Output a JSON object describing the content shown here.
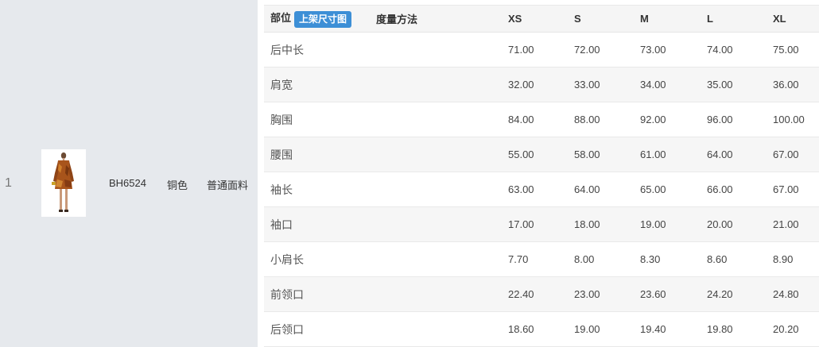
{
  "product": {
    "row_number": "1",
    "code": "BH6524",
    "color": "铜色",
    "fabric": "普通面料"
  },
  "size_table": {
    "header": {
      "part": "部位",
      "button": "上架尺寸图",
      "method": "度量方法",
      "sizes": [
        "XS",
        "S",
        "M",
        "L",
        "XL"
      ]
    },
    "rows": [
      {
        "part": "后中长",
        "method": "",
        "values": [
          "71.00",
          "72.00",
          "73.00",
          "74.00",
          "75.00"
        ]
      },
      {
        "part": "肩宽",
        "method": "",
        "values": [
          "32.00",
          "33.00",
          "34.00",
          "35.00",
          "36.00"
        ]
      },
      {
        "part": "胸围",
        "method": "",
        "values": [
          "84.00",
          "88.00",
          "92.00",
          "96.00",
          "100.00"
        ]
      },
      {
        "part": "腰围",
        "method": "",
        "values": [
          "55.00",
          "58.00",
          "61.00",
          "64.00",
          "67.00"
        ]
      },
      {
        "part": "袖长",
        "method": "",
        "values": [
          "63.00",
          "64.00",
          "65.00",
          "66.00",
          "67.00"
        ]
      },
      {
        "part": "袖口",
        "method": "",
        "values": [
          "17.00",
          "18.00",
          "19.00",
          "20.00",
          "21.00"
        ]
      },
      {
        "part": "小肩长",
        "method": "",
        "values": [
          "7.70",
          "8.00",
          "8.30",
          "8.60",
          "8.90"
        ]
      },
      {
        "part": "前领口",
        "method": "",
        "values": [
          "22.40",
          "23.00",
          "23.60",
          "24.20",
          "24.80"
        ]
      },
      {
        "part": "后领口",
        "method": "",
        "values": [
          "18.60",
          "19.00",
          "19.40",
          "19.80",
          "20.20"
        ]
      }
    ]
  }
}
